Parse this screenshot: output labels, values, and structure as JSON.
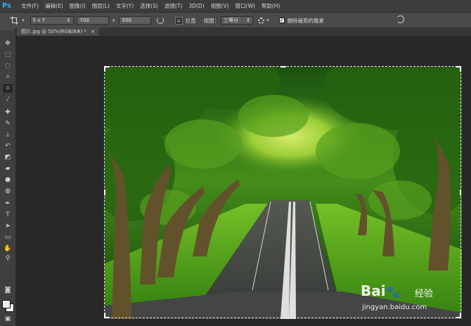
{
  "app": {
    "logo": "Ps"
  },
  "menu": [
    "文件(F)",
    "编辑(E)",
    "图像(I)",
    "图层(L)",
    "文字(Y)",
    "选择(S)",
    "滤镜(T)",
    "3D(D)",
    "视图(V)",
    "窗口(W)",
    "帮助(H)"
  ],
  "options": {
    "ratio_preset": "5 x 7",
    "width": "700",
    "separator": "x",
    "height": "500",
    "straighten_label": "拉直",
    "view_label": "视图：",
    "view_value": "三等分",
    "delete_cropped_label": "删除裁剪的像素",
    "delete_cropped_checked": true
  },
  "document": {
    "tab_title": "图片.jpg @ 50%(RGB/8#) *",
    "close": "×"
  },
  "tools": [
    {
      "glyph": "✥",
      "name": "move-icon"
    },
    {
      "glyph": "⬚",
      "name": "marquee-icon"
    },
    {
      "glyph": "◌",
      "name": "lasso-icon"
    },
    {
      "glyph": "✧",
      "name": "quick-select-icon"
    },
    {
      "glyph": "⌗",
      "name": "crop-icon"
    },
    {
      "glyph": "⁄",
      "name": "eyedropper-icon"
    },
    {
      "glyph": "✚",
      "name": "healing-brush-icon"
    },
    {
      "glyph": "✎",
      "name": "brush-icon"
    },
    {
      "glyph": "⊥",
      "name": "clone-stamp-icon"
    },
    {
      "glyph": "↶",
      "name": "history-brush-icon"
    },
    {
      "glyph": "◩",
      "name": "eraser-icon"
    },
    {
      "glyph": "▰",
      "name": "paint-bucket-icon"
    },
    {
      "glyph": "●",
      "name": "blur-icon"
    },
    {
      "glyph": "◍",
      "name": "dodge-icon"
    },
    {
      "glyph": "✒",
      "name": "pen-icon"
    },
    {
      "glyph": "T",
      "name": "type-icon"
    },
    {
      "glyph": "➤",
      "name": "path-select-icon"
    },
    {
      "glyph": "▭",
      "name": "shape-icon"
    },
    {
      "glyph": "✋",
      "name": "hand-icon"
    },
    {
      "glyph": "⚲",
      "name": "zoom-icon"
    }
  ],
  "watermark": {
    "logo": "Bai",
    "logo_mark": "du",
    "text": "经验",
    "url": "jingyan.baidu.com"
  },
  "colors": {
    "menubar": "#3c3c3c",
    "optbar": "#4a4a4a",
    "workspace": "#282828",
    "ps_blue": "#31a8ff"
  }
}
